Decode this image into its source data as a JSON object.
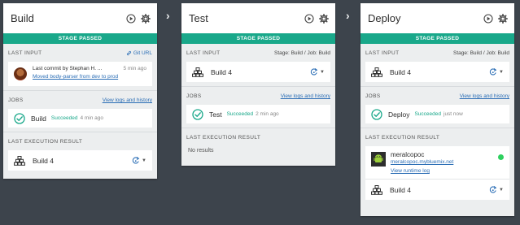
{
  "colors": {
    "accent": "#19a88a",
    "link": "#2a6db5",
    "running": "#2ed05f",
    "background": "#3d444c"
  },
  "stages": [
    {
      "title": "Build",
      "banner": "STAGE PASSED",
      "last_input": {
        "label": "LAST INPUT",
        "git_url": "Git URL",
        "commit_author": "Last commit by Stephan H. ...",
        "commit_ago": "5 min ago",
        "commit_message": "Moved body-parser from dev to prod"
      },
      "jobs": {
        "label": "JOBS",
        "link": "View logs and history",
        "name": "Build",
        "status": "Succeeded",
        "time": "4 min ago"
      },
      "last_execution": {
        "label": "LAST EXECUTION RESULT",
        "build": "Build 4"
      }
    },
    {
      "title": "Test",
      "banner": "STAGE PASSED",
      "last_input": {
        "label": "LAST INPUT",
        "source": "Stage: Build  /  Job: Build",
        "build": "Build 4"
      },
      "jobs": {
        "label": "JOBS",
        "link": "View logs and history",
        "name": "Test",
        "status": "Succeeded",
        "time": "2 min ago"
      },
      "last_execution": {
        "label": "LAST EXECUTION RESULT",
        "empty": "No results"
      }
    },
    {
      "title": "Deploy",
      "banner": "STAGE PASSED",
      "last_input": {
        "label": "LAST INPUT",
        "source": "Stage: Build  /  Job: Build",
        "build": "Build 4"
      },
      "jobs": {
        "label": "JOBS",
        "link": "View logs and history",
        "name": "Deploy",
        "status": "Succeeded",
        "time": "just now"
      },
      "last_execution": {
        "label": "LAST EXECUTION RESULT",
        "app_name": "meralcopoc",
        "app_url": "meralcopoc.mybluemix.net",
        "runtime_log": "View runtime log",
        "build": "Build 4"
      }
    }
  ],
  "icons": {
    "run": "play-circle-icon",
    "settings": "gear-icon",
    "arrow": "chevron-right-icon",
    "build": "build-stack-icon",
    "check": "check-circle-icon",
    "trigger": "redeploy-icon"
  }
}
